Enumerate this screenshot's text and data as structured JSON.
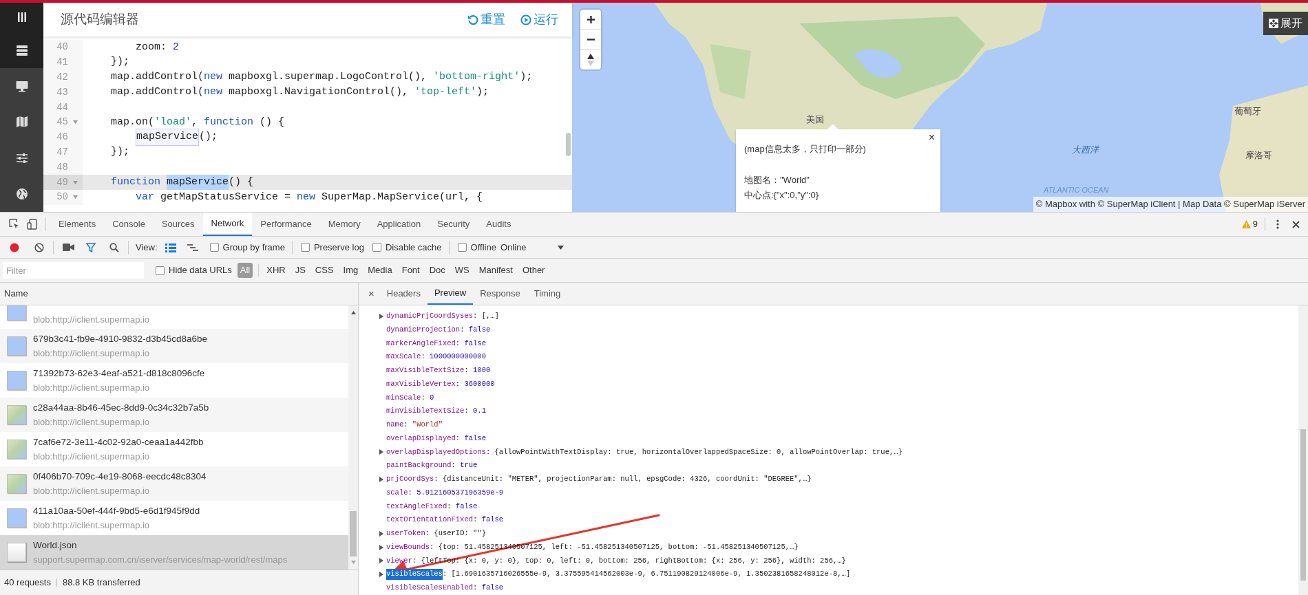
{
  "sidebar": {
    "items": [
      {
        "kind": "server",
        "selected": true
      },
      {
        "kind": "monitor",
        "selected": false
      },
      {
        "kind": "map",
        "selected": false
      },
      {
        "kind": "sliders",
        "selected": false
      },
      {
        "kind": "globe",
        "selected": false
      }
    ]
  },
  "editor": {
    "title": "源代码编辑器",
    "buttons": [
      {
        "kind": "reset",
        "label": "重置"
      },
      {
        "kind": "run",
        "label": "运行"
      }
    ],
    "lines": [
      {
        "number": "40",
        "kind": "inner",
        "fold": false,
        "active": false,
        "tokens": [
          {
            "kind": "plain",
            "text": "zoom: "
          },
          {
            "kind": "number",
            "text": "2"
          }
        ]
      },
      {
        "number": "41",
        "kind": "outer",
        "fold": false,
        "active": false,
        "tokens": [
          {
            "kind": "plain",
            "text": "});"
          }
        ]
      },
      {
        "number": "42",
        "kind": "outer",
        "fold": false,
        "active": false,
        "tokens": [
          {
            "kind": "plain",
            "text": "map.addControl("
          },
          {
            "kind": "keyword",
            "text": "new"
          },
          {
            "kind": "plain",
            "text": " mapboxgl.supermap.LogoControl(), "
          },
          {
            "kind": "string",
            "text": "'bottom-right'"
          },
          {
            "kind": "plain",
            "text": ");"
          }
        ]
      },
      {
        "number": "43",
        "kind": "outer",
        "fold": false,
        "active": false,
        "tokens": [
          {
            "kind": "plain",
            "text": "map.addControl("
          },
          {
            "kind": "keyword",
            "text": "new"
          },
          {
            "kind": "plain",
            "text": " mapboxgl.NavigationControl(), "
          },
          {
            "kind": "string",
            "text": "'top-left'"
          },
          {
            "kind": "plain",
            "text": ");"
          }
        ]
      },
      {
        "number": "44",
        "fold": false,
        "active": false
      },
      {
        "number": "45",
        "kind": "outer",
        "fold": true,
        "active": false,
        "tokens": [
          {
            "kind": "plain",
            "text": "map.on("
          },
          {
            "kind": "string",
            "text": "'load'"
          },
          {
            "kind": "plain",
            "text": ", "
          },
          {
            "kind": "keyword",
            "text": "function"
          },
          {
            "kind": "plain",
            "text": " () {"
          }
        ]
      },
      {
        "number": "46",
        "kind": "inner",
        "fold": false,
        "active": false,
        "tokens": [
          {
            "kind": "match",
            "text": "mapService"
          },
          {
            "kind": "plain",
            "text": "();"
          }
        ]
      },
      {
        "number": "47",
        "kind": "outer",
        "fold": false,
        "active": false,
        "tokens": [
          {
            "kind": "plain",
            "text": "});"
          }
        ]
      },
      {
        "number": "48",
        "fold": false,
        "active": false
      },
      {
        "number": "49",
        "kind": "outer",
        "fold": true,
        "active": true,
        "tokens": [
          {
            "kind": "keyword",
            "text": "function "
          },
          {
            "kind": "selection",
            "text": "mapService"
          },
          {
            "kind": "plain",
            "text": "() {"
          }
        ]
      },
      {
        "number": "50",
        "kind": "inner",
        "fold": true,
        "active": false,
        "tokens": [
          {
            "kind": "keyword",
            "text": "var"
          },
          {
            "kind": "plain",
            "text": " getMapStatusService = "
          },
          {
            "kind": "keyword",
            "text": "new"
          },
          {
            "kind": "plain",
            "text": " SuperMap.MapService(url, {"
          }
        ]
      }
    ]
  },
  "map": {
    "expand_label": "展开",
    "labels": [
      "美国",
      "大西洋",
      "ATLANTIC OCEAN",
      "葡萄牙",
      "摩洛哥"
    ],
    "popup": {
      "close": "×",
      "lines": [
        "(map信息太多，只打印一部分)",
        "地图名：\"World\"",
        "中心点:{\"x\":0,\"y\":0}"
      ]
    },
    "attribution": "© Mapbox with © SuperMap iClient | Map Data © SuperMap iServer"
  },
  "devtools": {
    "tabs": [
      {
        "label": "Elements",
        "selected": false
      },
      {
        "label": "Console",
        "selected": false
      },
      {
        "label": "Sources",
        "selected": false
      },
      {
        "label": "Network",
        "selected": true
      },
      {
        "label": "Performance",
        "selected": false
      },
      {
        "label": "Memory",
        "selected": false
      },
      {
        "label": "Application",
        "selected": false
      },
      {
        "label": "Security",
        "selected": false
      },
      {
        "label": "Audits",
        "selected": false
      }
    ],
    "warning_count": "9",
    "toolbar": {
      "recording": true,
      "filter_shown": true,
      "view_label": "View:",
      "view_modes": [
        {
          "kind": "list",
          "selected": true
        },
        {
          "kind": "waterfall",
          "selected": false
        }
      ],
      "checkboxes": [
        {
          "label": "Group by frame",
          "checked": false
        },
        {
          "label": "Preserve log",
          "checked": false
        },
        {
          "label": "Disable cache",
          "checked": false
        },
        {
          "label": "Offline",
          "checked": false
        }
      ],
      "throttling": "Online"
    },
    "filter": {
      "placeholder": "Filter",
      "hide_data_urls": {
        "label": "Hide data URLs",
        "checked": false
      },
      "types": [
        {
          "label": "All",
          "selected": true
        },
        {
          "label": "XHR",
          "selected": false
        },
        {
          "label": "JS",
          "selected": false
        },
        {
          "label": "CSS",
          "selected": false
        },
        {
          "label": "Img",
          "selected": false
        },
        {
          "label": "Media",
          "selected": false
        },
        {
          "label": "Font",
          "selected": false
        },
        {
          "label": "Doc",
          "selected": false
        },
        {
          "label": "WS",
          "selected": false
        },
        {
          "label": "Manifest",
          "selected": false
        },
        {
          "label": "Other",
          "selected": false
        }
      ]
    },
    "requests": {
      "column": "Name",
      "rows": [
        {
          "url": "blob:http://iclient.supermap.io",
          "kind": "ocean",
          "selected": false
        },
        {
          "name": "679b3c41-fb9e-4910-9832-d3b45cd8a6be",
          "url": "blob:http://iclient.supermap.io",
          "kind": "ocean",
          "selected": false
        },
        {
          "name": "71392b73-62e3-4eaf-a521-d818c8096cfe",
          "url": "blob:http://iclient.supermap.io",
          "kind": "ocean",
          "selected": false
        },
        {
          "name": "c28a44aa-8b46-45ec-8dd9-0c34c32b7a5b",
          "url": "blob:http://iclient.supermap.io",
          "kind": "land",
          "selected": false
        },
        {
          "name": "7caf6e72-3e11-4c02-92a0-ceaa1a442fbb",
          "url": "blob:http://iclient.supermap.io",
          "kind": "land",
          "selected": false
        },
        {
          "name": "0f406b70-709c-4e19-8068-eecdc48c8304",
          "url": "blob:http://iclient.supermap.io",
          "kind": "land",
          "selected": false
        },
        {
          "name": "411a10aa-50ef-444f-9bd5-e6d1f945f9dd",
          "url": "blob:http://iclient.supermap.io",
          "kind": "ocean",
          "selected": false
        },
        {
          "name": "World.json",
          "url": "support.supermap.com.cn/iserver/services/map-world/rest/maps",
          "kind": "document",
          "selected": true
        }
      ],
      "summary": [
        "40 requests",
        "88.8 KB transferred"
      ]
    },
    "detail": {
      "close": "×",
      "tabs": [
        {
          "label": "Headers",
          "selected": false
        },
        {
          "label": "Preview",
          "selected": true
        },
        {
          "label": "Response",
          "selected": false
        },
        {
          "label": "Timing",
          "selected": false
        }
      ],
      "separator": ": ",
      "lines": [
        {
          "key": "dynamicPrjCoordSyses",
          "value": "[,…]",
          "kind": "object",
          "expandable": true,
          "highlighted": false
        },
        {
          "key": "dynamicProjection",
          "value": "false",
          "kind": "literal",
          "expandable": false,
          "highlighted": false
        },
        {
          "key": "markerAngleFixed",
          "value": "false",
          "kind": "literal",
          "expandable": false,
          "highlighted": false
        },
        {
          "key": "maxScale",
          "value": "1000000000000",
          "kind": "literal",
          "expandable": false,
          "highlighted": false
        },
        {
          "key": "maxVisibleTextSize",
          "value": "1000",
          "kind": "literal",
          "expandable": false,
          "highlighted": false
        },
        {
          "key": "maxVisibleVertex",
          "value": "3600000",
          "kind": "literal",
          "expandable": false,
          "highlighted": false
        },
        {
          "key": "minScale",
          "value": "0",
          "kind": "literal",
          "expandable": false,
          "highlighted": false
        },
        {
          "key": "minVisibleTextSize",
          "value": "0.1",
          "kind": "literal",
          "expandable": false,
          "highlighted": false
        },
        {
          "key": "name",
          "value": "\"World\"",
          "kind": "string",
          "expandable": false,
          "highlighted": false
        },
        {
          "key": "overlapDisplayed",
          "value": "false",
          "kind": "literal",
          "expandable": false,
          "highlighted": false
        },
        {
          "key": "overlapDisplayedOptions",
          "value": "{allowPointWithTextDisplay: true, horizontalOverlappedSpaceSize: 0, allowPointOverlap: true,…}",
          "kind": "object",
          "expandable": true,
          "highlighted": false
        },
        {
          "key": "paintBackground",
          "value": "true",
          "kind": "literal",
          "expandable": false,
          "highlighted": false
        },
        {
          "key": "prjCoordSys",
          "value": "{distanceUnit: \"METER\", projectionParam: null, epsgCode: 4326, coordUnit: \"DEGREE\",…}",
          "kind": "object",
          "expandable": true,
          "highlighted": false
        },
        {
          "key": "scale",
          "value": "5.912160537196359e-9",
          "kind": "literal",
          "expandable": false,
          "highlighted": false
        },
        {
          "key": "textAngleFixed",
          "value": "false",
          "kind": "literal",
          "expandable": false,
          "highlighted": false
        },
        {
          "key": "textOrientationFixed",
          "value": "false",
          "kind": "literal",
          "expandable": false,
          "highlighted": false
        },
        {
          "key": "userToken",
          "value": "{userID: \"\"}",
          "kind": "object",
          "expandable": true,
          "highlighted": false
        },
        {
          "key": "viewBounds",
          "value": "{top: 51.458251340507125, left: -51.458251340507125, bottom: -51.458251340507125,…}",
          "kind": "object",
          "expandable": true,
          "highlighted": false
        },
        {
          "key": "viewer",
          "value": "{leftTop: {x: 0, y: 0}, top: 0, left: 0, bottom: 256, rightBottom: {x: 256, y: 256}, width: 256,…}",
          "kind": "object",
          "expandable": true,
          "highlighted": false
        },
        {
          "key": "visibleScales",
          "value": "[1.6901635716026555e-9, 3.375595414562003e-9, 6.751190829124006e-9, 1.3502381658248012e-8,…]",
          "kind": "object",
          "expandable": true,
          "highlighted": true
        },
        {
          "key": "visibleScalesEnabled",
          "value": "false",
          "kind": "literal",
          "expandable": false,
          "highlighted": false
        }
      ]
    }
  }
}
